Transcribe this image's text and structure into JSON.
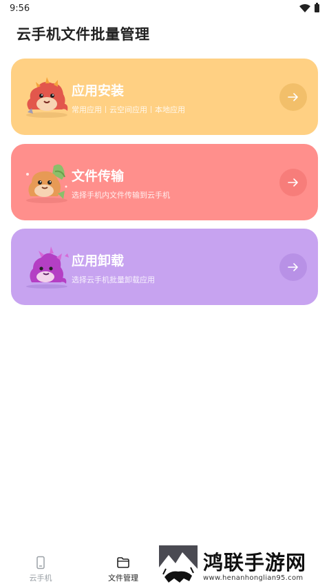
{
  "status_bar": {
    "time": "9:56"
  },
  "header": {
    "title": "云手机文件批量管理"
  },
  "cards": [
    {
      "title": "应用安装",
      "subtitles": [
        "常用应用",
        "云空间应用",
        "本地应用"
      ],
      "color": "#ffd083",
      "arrow_color": "#f2bf6a",
      "icon": "dragon-mascot-red"
    },
    {
      "title": "文件传输",
      "subtitle": "选择手机内文件传输到云手机",
      "color": "#ff8f8c",
      "arrow_color": "#f77d7a",
      "icon": "dragon-mascot-orange"
    },
    {
      "title": "应用卸载",
      "subtitle": "选择云手机批量卸载应用",
      "color": "#c7a3f0",
      "arrow_color": "#b891e6",
      "icon": "dragon-mascot-purple"
    }
  ],
  "bottom_nav": [
    {
      "label": "云手机",
      "icon": "phone-icon",
      "active": false
    },
    {
      "label": "文件管理",
      "icon": "folder-icon",
      "active": true
    }
  ],
  "watermark": {
    "title": "鸿联手游网",
    "url": "www.henanhonglian95.com"
  }
}
